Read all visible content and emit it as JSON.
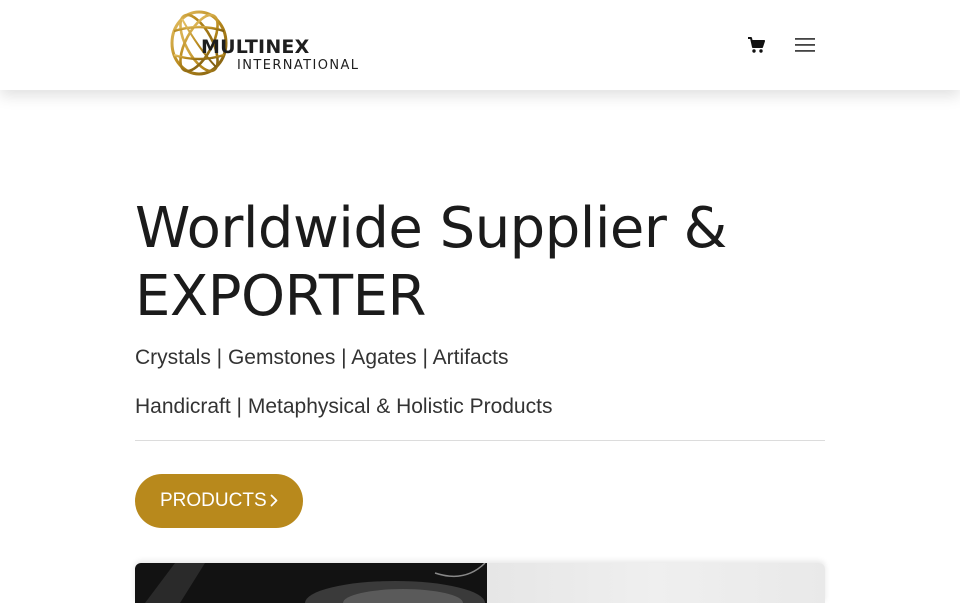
{
  "header": {
    "brand_name": "MULTINEX",
    "brand_sub": "INTERNATIONAL",
    "icons": [
      "globe-logo-icon",
      "shopping-cart-icon",
      "hamburger-menu-icon"
    ]
  },
  "hero": {
    "title_line1": "Worldwide Supplier &",
    "title_line2": "EXPORTER",
    "subtitle1": "Crystals | Gemstones | Agates | Artifacts",
    "subtitle2": "Handicraft | Metaphysical & Holistic Products",
    "cta_label": "PRODUCTS"
  },
  "colors": {
    "accent": "#b8891c",
    "text": "#1b1b1b",
    "background": "#ffffff"
  }
}
